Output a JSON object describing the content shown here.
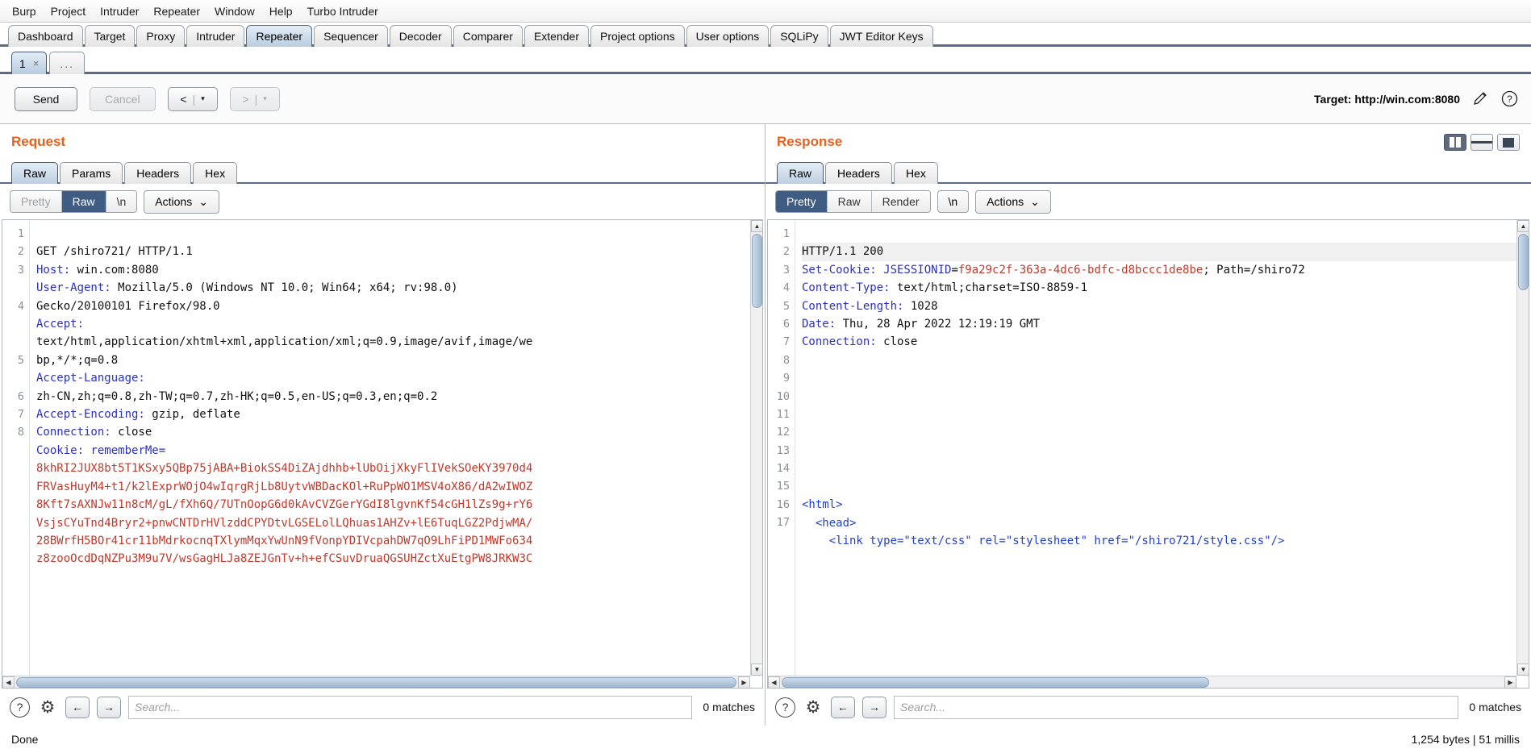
{
  "menu": {
    "items": [
      "Burp",
      "Project",
      "Intruder",
      "Repeater",
      "Window",
      "Help",
      "Turbo Intruder"
    ]
  },
  "main_tabs": [
    {
      "label": "Dashboard",
      "active": false
    },
    {
      "label": "Target",
      "active": false
    },
    {
      "label": "Proxy",
      "active": false
    },
    {
      "label": "Intruder",
      "active": false
    },
    {
      "label": "Repeater",
      "active": true
    },
    {
      "label": "Sequencer",
      "active": false
    },
    {
      "label": "Decoder",
      "active": false
    },
    {
      "label": "Comparer",
      "active": false
    },
    {
      "label": "Extender",
      "active": false
    },
    {
      "label": "Project options",
      "active": false
    },
    {
      "label": "User options",
      "active": false
    },
    {
      "label": "SQLiPy",
      "active": false
    },
    {
      "label": "JWT Editor Keys",
      "active": false
    }
  ],
  "repeater_tabs": {
    "tab_label": "1",
    "close_glyph": "×",
    "add_label": "..."
  },
  "toolbar": {
    "send_label": "Send",
    "cancel_label": "Cancel",
    "back_label": "<",
    "forward_label": ">",
    "caret": "▾",
    "separator": "|",
    "target_label": "Target: http://win.com:8080"
  },
  "request": {
    "title": "Request",
    "tabs": [
      {
        "label": "Raw",
        "active": true
      },
      {
        "label": "Params",
        "active": false
      },
      {
        "label": "Headers",
        "active": false
      },
      {
        "label": "Hex",
        "active": false
      }
    ],
    "controls": {
      "pretty": "Pretty",
      "raw": "Raw",
      "newline": "\\n",
      "actions": "Actions",
      "actions_caret": "⌄"
    },
    "line_numbers": [
      "1",
      "2",
      "3",
      "",
      "4",
      "",
      "",
      "5",
      "",
      "6",
      "7",
      "8",
      "",
      "",
      "",
      "",
      "",
      "",
      ""
    ],
    "lines": [
      {
        "type": "plain",
        "text": "GET /shiro721/ HTTP/1.1"
      },
      {
        "type": "header",
        "name": "Host:",
        "value": " win.com:8080"
      },
      {
        "type": "header",
        "name": "User-Agent:",
        "value": " Mozilla/5.0 (Windows NT 10.0; Win64; x64; rv:98.0)"
      },
      {
        "type": "cont",
        "text": "Gecko/20100101 Firefox/98.0"
      },
      {
        "type": "header",
        "name": "Accept:",
        "value": ""
      },
      {
        "type": "cont",
        "text": "text/html,application/xhtml+xml,application/xml;q=0.9,image/avif,image/we"
      },
      {
        "type": "cont",
        "text": "bp,*/*;q=0.8"
      },
      {
        "type": "header",
        "name": "Accept-Language:",
        "value": ""
      },
      {
        "type": "cont",
        "text": "zh-CN,zh;q=0.8,zh-TW;q=0.7,zh-HK;q=0.5,en-US;q=0.3,en;q=0.2"
      },
      {
        "type": "header",
        "name": "Accept-Encoding:",
        "value": " gzip, deflate"
      },
      {
        "type": "header",
        "name": "Connection:",
        "value": " close"
      },
      {
        "type": "cookie",
        "name": "Cookie:",
        "value": " rememberMe="
      },
      {
        "type": "red",
        "text": "8khRI2JUX8bt5T1KSxy5QBp75jABA+BiokSS4DiZAjdhhb+lUbOijXkyFlIVekSOeKY3970d4"
      },
      {
        "type": "red",
        "text": "FRVasHuyM4+t1/k2lExprWOjO4wIqrgRjLb8UytvWBDacKOl+RuPpWO1MSV4oX86/dA2wIWOZ"
      },
      {
        "type": "red",
        "text": "8Kft7sAXNJw11n8cM/gL/fXh6Q/7UTnOopG6d0kAvCVZGerYGdI8lgvnKf54cGH1lZs9g+rY6"
      },
      {
        "type": "red",
        "text": "VsjsCYuTnd4Bryr2+pnwCNTDrHVlzddCPYDtvLGSELolLQhuas1AHZv+lE6TuqLGZ2PdjwMA/"
      },
      {
        "type": "red",
        "text": "28BWrfH5BOr41cr11bMdrkocnqTXlymMqxYwUnN9fVonpYDIVcpahDW7qO9LhFiPD1MWFo634"
      },
      {
        "type": "red",
        "text": "z8zooOcdDqNZPu3M9u7V/wsGagHLJa8ZEJGnTv+h+efCSuvDruaQGSUHZctXuEtgPW8JRKW3C"
      }
    ],
    "search": {
      "placeholder": "Search...",
      "matches": "0 matches",
      "help_glyph": "?",
      "gear_glyph": "⚙",
      "prev_glyph": "←",
      "next_glyph": "→"
    }
  },
  "response": {
    "title": "Response",
    "tabs": [
      {
        "label": "Raw",
        "active": true
      },
      {
        "label": "Headers",
        "active": false
      },
      {
        "label": "Hex",
        "active": false
      }
    ],
    "controls": {
      "pretty": "Pretty",
      "raw": "Raw",
      "render": "Render",
      "newline": "\\n",
      "actions": "Actions",
      "actions_caret": "⌄"
    },
    "view_modes": [
      "split-view",
      "rows-view",
      "single-view"
    ],
    "line_numbers": [
      "1",
      "2",
      "3",
      "4",
      "5",
      "6",
      "7",
      "8",
      "9",
      "10",
      "11",
      "12",
      "13",
      "14",
      "15",
      "16",
      "17"
    ],
    "lines": [
      {
        "type": "status",
        "text": "HTTP/1.1 200"
      },
      {
        "type": "setcookie",
        "name": "Set-Cookie:",
        "key": " JSESSIONID",
        "eq": "=",
        "value": "f9a29c2f-363a-4dc6-bdfc-d8bccc1de8be",
        "tail": "; Path=/shiro72"
      },
      {
        "type": "header",
        "name": "Content-Type:",
        "value": " text/html;charset=ISO-8859-1"
      },
      {
        "type": "header",
        "name": "Content-Length:",
        "value": " 1028"
      },
      {
        "type": "header",
        "name": "Date:",
        "value": " Thu, 28 Apr 2022 12:19:19 GMT"
      },
      {
        "type": "header",
        "name": "Connection:",
        "value": " close"
      },
      {
        "type": "blank",
        "text": ""
      },
      {
        "type": "blank",
        "text": ""
      },
      {
        "type": "blank",
        "text": ""
      },
      {
        "type": "blank",
        "text": ""
      },
      {
        "type": "blank",
        "text": ""
      },
      {
        "type": "blank",
        "text": ""
      },
      {
        "type": "blank",
        "text": ""
      },
      {
        "type": "blank",
        "text": ""
      },
      {
        "type": "html_open",
        "text": "<html>"
      },
      {
        "type": "html_head",
        "text": "  <head>"
      },
      {
        "type": "html_link",
        "text": "    <link type=\"text/css\" rel=\"stylesheet\" href=\"/shiro721/style.css\"/>"
      }
    ],
    "search": {
      "placeholder": "Search...",
      "matches": "0 matches",
      "help_glyph": "?",
      "gear_glyph": "⚙",
      "prev_glyph": "←",
      "next_glyph": "→"
    }
  },
  "status": {
    "left": "Done",
    "right": "1,254 bytes | 51 millis"
  },
  "colors": {
    "accent_orange": "#e8601c",
    "header_blue": "#2b30c4",
    "value_red": "#c0392b",
    "tab_active": "#bdcfe1"
  }
}
